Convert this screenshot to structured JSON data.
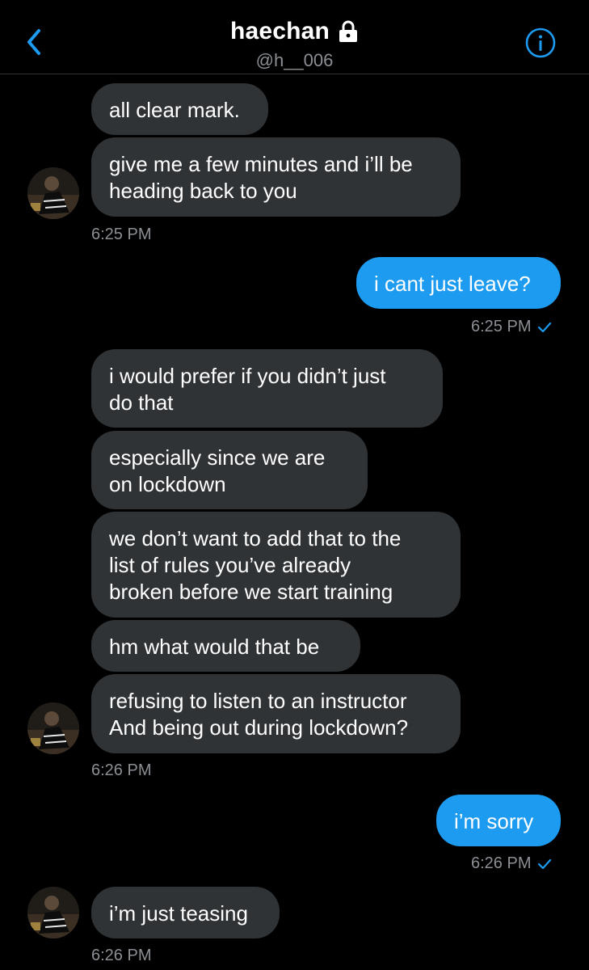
{
  "header": {
    "title": "haechan",
    "handle": "@h__006"
  },
  "messages": {
    "m1": "all clear mark.",
    "m2_line1": "give me a few minutes and i’ll be",
    "m2_line2": "heading back to you",
    "t1": "6:25 PM",
    "m3": "i cant just leave?",
    "t2": "6:25 PM",
    "m4_line1": "i would prefer if you didn’t just",
    "m4_line2": "do that",
    "m5_line1": "especially since we are",
    "m5_line2": "on lockdown",
    "m6_line1": "we don’t want to add that to the",
    "m6_line2": "list of rules you’ve already",
    "m6_line3": "broken before we start training",
    "m7": "hm what would that be",
    "m8_line1": "refusing to listen to an instructor",
    "m8_line2": "And being out during lockdown?",
    "t3": "6:26 PM",
    "m9": "i’m sorry",
    "t4": "6:26 PM",
    "m10": "i’m just teasing",
    "t5": "6:26 PM"
  },
  "colors": {
    "background": "#000000",
    "incoming_bubble": "#2f3336",
    "outgoing_bubble": "#1d9bf0",
    "accent": "#1d9bf0",
    "muted_text": "#8b8f94"
  },
  "icons": {
    "back": "chevron-left-icon",
    "lock": "lock-icon",
    "info": "info-icon",
    "read": "check-icon"
  }
}
